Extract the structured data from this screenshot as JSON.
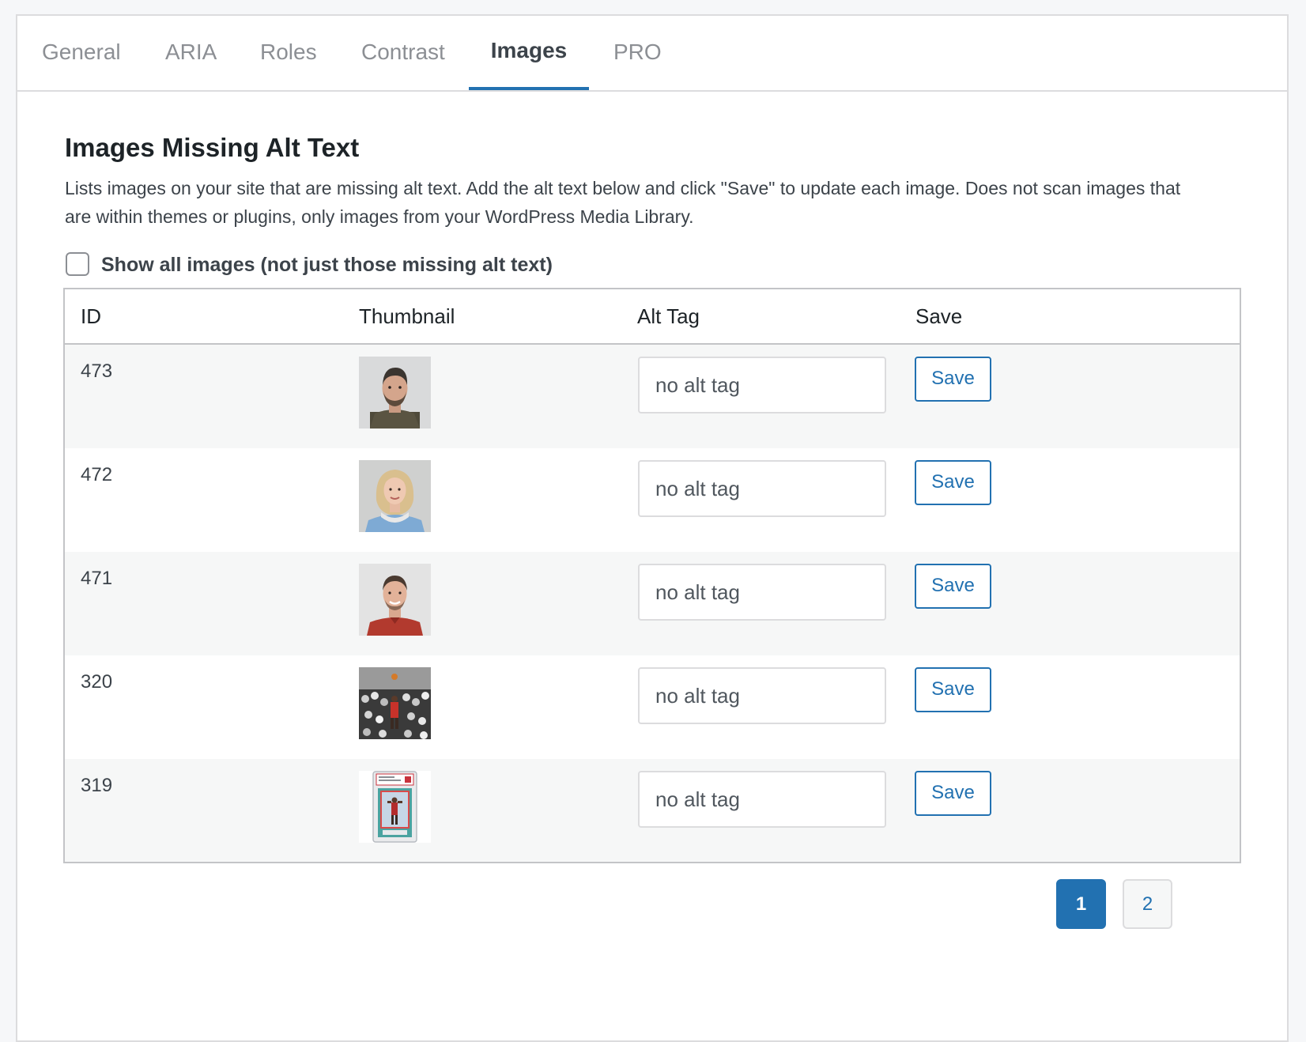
{
  "tabs": [
    {
      "label": "General"
    },
    {
      "label": "ARIA"
    },
    {
      "label": "Roles"
    },
    {
      "label": "Contrast"
    },
    {
      "label": "Images",
      "active": true
    },
    {
      "label": "PRO"
    }
  ],
  "section": {
    "title": "Images Missing Alt Text",
    "description": "Lists images on your site that are missing alt text. Add the alt text below and click \"Save\" to update each image. Does not scan images that are within themes or plugins, only images from your WordPress Media Library.",
    "show_all_label": "Show all images (not just those missing alt text)",
    "show_all_checked": false
  },
  "table": {
    "headers": {
      "id": "ID",
      "thumbnail": "Thumbnail",
      "alt": "Alt Tag",
      "save": "Save"
    },
    "rows": [
      {
        "id": "473",
        "alt_placeholder": "no alt tag",
        "save_label": "Save",
        "thumb": "portrait-man-beard"
      },
      {
        "id": "472",
        "alt_placeholder": "no alt tag",
        "save_label": "Save",
        "thumb": "portrait-woman-headphones"
      },
      {
        "id": "471",
        "alt_placeholder": "no alt tag",
        "save_label": "Save",
        "thumb": "portrait-man-red-shirt"
      },
      {
        "id": "320",
        "alt_placeholder": "no alt tag",
        "save_label": "Save",
        "thumb": "basketball-crowd-photo"
      },
      {
        "id": "319",
        "alt_placeholder": "no alt tag",
        "save_label": "Save",
        "thumb": "graded-trading-card"
      }
    ]
  },
  "pagination": {
    "current": "1",
    "next": "2"
  },
  "colors": {
    "accent": "#2271b1",
    "tab_inactive": "#8c8f94",
    "border": "#dcdcde"
  }
}
